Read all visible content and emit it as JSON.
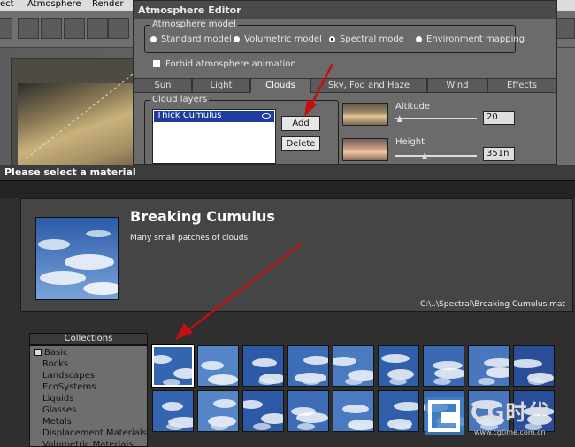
{
  "menubar": {
    "items": [
      "ect",
      "Atmosphere",
      "Render"
    ]
  },
  "atmosphere_editor": {
    "title": "Atmosphere Editor",
    "model_group_label": "Atmosphere model",
    "models": [
      "Standard model",
      "Volumetric model",
      "Spectral mode",
      "Environment mapping"
    ],
    "forbid_label": "Forbid atmosphere animation",
    "tabs": [
      "Sun",
      "Light",
      "Clouds",
      "Sky, Fog and Haze",
      "Wind",
      "Effects"
    ],
    "active_tab": "Clouds",
    "cloud_layers_label": "Cloud layers",
    "cloud_layers": [
      "Thick Cumulus"
    ],
    "add_label": "Add",
    "delete_label": "Delete",
    "altitude_label": "Altitude",
    "altitude_value": "20",
    "altitude_level": 0.02,
    "height_label": "Height",
    "height_value": "351n",
    "height_level": 0.35
  },
  "material_dialog": {
    "title": "Please select a material",
    "material_name": "Breaking Cumulus",
    "material_description": "Many small patches of clouds.",
    "material_path": "C:\\..\\Spectral\\Breaking Cumulus.mat",
    "collections_header": "Collections",
    "collections": [
      "Basic",
      "Rocks",
      "Landscapes",
      "EcoSystems",
      "Liquids",
      "Glasses",
      "Metals",
      "Displacement Materials",
      "Volumetric Materials"
    ],
    "selected_thumbnail": 0,
    "thumbnail_count": 18
  },
  "watermark": {
    "brand": "CG时代",
    "url": "www.cgtime.com.cn"
  },
  "colors": {
    "arrow": "#c01010",
    "selection_blue": "#1e3c9e",
    "sky_blue": "#3f6fb4"
  }
}
